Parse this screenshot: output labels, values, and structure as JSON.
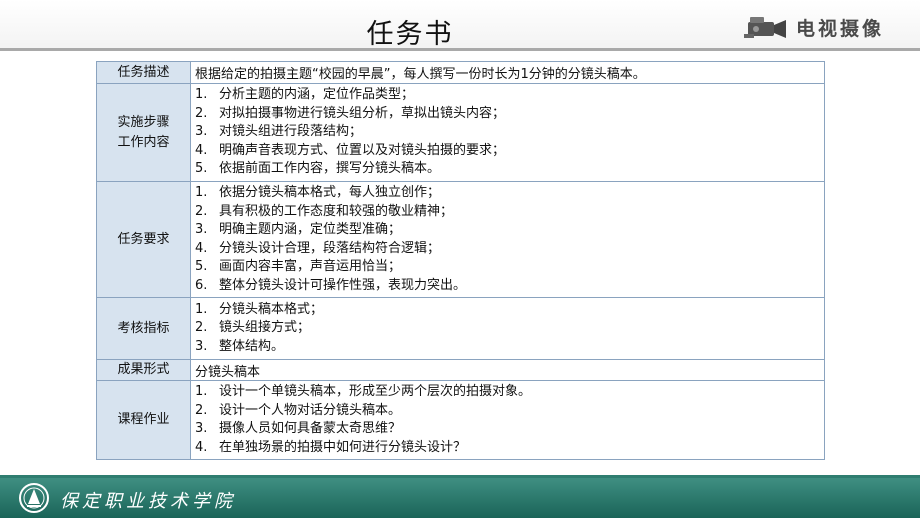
{
  "header": {
    "title": "任务书",
    "brand_text": "电视摄像",
    "brand_icon": "camera-icon"
  },
  "table": {
    "rows": [
      {
        "label": "任务描述",
        "text": "根据给定的拍摄主题“校园的早晨”，每人撰写一份时长为1分钟的分镜头稿本。"
      },
      {
        "label": "实施步骤工作内容",
        "items": [
          {
            "num": "1.",
            "text": "分析主题的内涵，定位作品类型；"
          },
          {
            "num": "2.",
            "text": "对拟拍摄事物进行镜头组分析，草拟出镜头内容；"
          },
          {
            "num": "3.",
            "text": "对镜头组进行段落结构；"
          },
          {
            "num": "4.",
            "text": "明确声音表现方式、位置以及对镜头拍摄的要求；"
          },
          {
            "num": "5.",
            "text": "依据前面工作内容，撰写分镜头稿本。"
          }
        ]
      },
      {
        "label": "任务要求",
        "items": [
          {
            "num": "1.",
            "text": "依据分镜头稿本格式，每人独立创作；"
          },
          {
            "num": "2.",
            "text": "具有积极的工作态度和较强的敬业精神；"
          },
          {
            "num": "3.",
            "text": "明确主题内涵，定位类型准确；"
          },
          {
            "num": "4.",
            "text": "分镜头设计合理，段落结构符合逻辑；"
          },
          {
            "num": "5.",
            "text": "画面内容丰富，声音运用恰当；"
          },
          {
            "num": "6.",
            "text": "整体分镜头设计可操作性强，表现力突出。"
          }
        ]
      },
      {
        "label": "考核指标",
        "items": [
          {
            "num": "1.",
            "text": "分镜头稿本格式；"
          },
          {
            "num": "2.",
            "text": "镜头组接方式；"
          },
          {
            "num": "3.",
            "text": "整体结构。"
          }
        ]
      },
      {
        "label": "成果形式",
        "text": "分镜头稿本"
      },
      {
        "label": "课程作业",
        "items": [
          {
            "num": "1.",
            "text": "设计一个单镜头稿本，形成至少两个层次的拍摄对象。"
          },
          {
            "num": "2.",
            "text": "设计一个人物对话分镜头稿本。"
          },
          {
            "num": "3.",
            "text": "摄像人员如何具备蒙太奇思维？"
          },
          {
            "num": "4.",
            "text": "在单独场景的拍摄中如何进行分镜头设计？"
          }
        ]
      }
    ]
  },
  "footer": {
    "school_name": "保定职业技术学院",
    "logo_icon": "school-logo-icon"
  },
  "colors": {
    "label_bg": "#d7e3ef",
    "border": "#8aa3bf",
    "footer_bg": "#1a6458"
  }
}
